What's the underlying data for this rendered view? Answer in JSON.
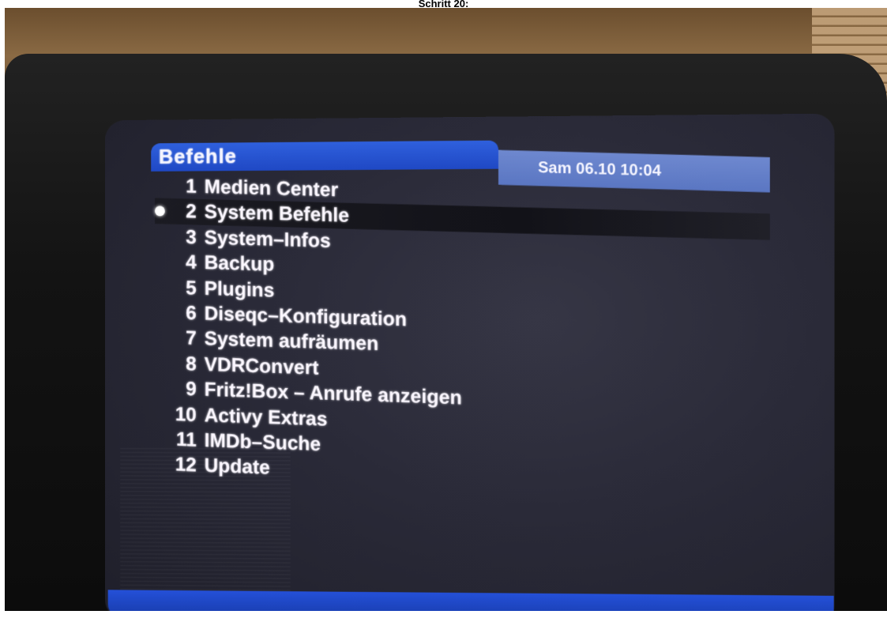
{
  "caption": "Schritt 20:",
  "osd": {
    "title": "Befehle",
    "clock": "Sam 06.10 10:04",
    "selected_index": 1,
    "items": [
      {
        "number": "1",
        "label": "Medien Center"
      },
      {
        "number": "2",
        "label": "System Befehle"
      },
      {
        "number": "3",
        "label": "System–Infos"
      },
      {
        "number": "4",
        "label": "Backup"
      },
      {
        "number": "5",
        "label": "Plugins"
      },
      {
        "number": "6",
        "label": "Diseqc–Konfiguration"
      },
      {
        "number": "7",
        "label": "System aufräumen"
      },
      {
        "number": "8",
        "label": "VDRConvert"
      },
      {
        "number": "9",
        "label": "Fritz!Box – Anrufe anzeigen"
      },
      {
        "number": "10",
        "label": "Activy Extras"
      },
      {
        "number": "11",
        "label": "IMDb–Suche"
      },
      {
        "number": "12",
        "label": "Update"
      }
    ]
  },
  "colors": {
    "header_blue": "#2f60dd",
    "clock_panel": "#6e88cf",
    "screen_bg": "#2a2a38",
    "text": "#fbf7ff"
  }
}
